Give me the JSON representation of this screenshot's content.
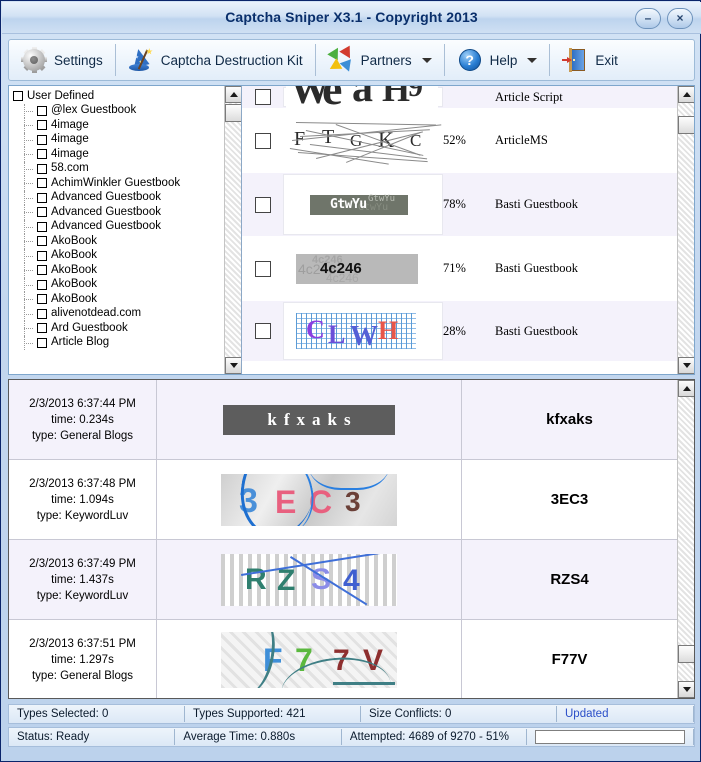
{
  "window": {
    "title": "Captcha Sniper X3.1 - Copyright 2013",
    "minimize_label": "–",
    "close_label": "×"
  },
  "toolbar": {
    "items": [
      {
        "label": "Settings",
        "icon": "gear-icon",
        "caret": false
      },
      {
        "label": "Captcha Destruction Kit",
        "icon": "wizard-hat-icon",
        "caret": false
      },
      {
        "label": "Partners",
        "icon": "arrows-icon",
        "caret": true
      },
      {
        "label": "Help",
        "icon": "question-circle-icon",
        "caret": true
      },
      {
        "label": "Exit",
        "icon": "exit-door-icon",
        "caret": false
      }
    ]
  },
  "tree": {
    "root": "User Defined",
    "items": [
      "@lex Guestbook",
      "4image",
      "4image",
      "4image",
      "58.com",
      "AchimWinkler Guestbook",
      "Advanced Guestbook",
      "Advanced Guestbook",
      "Advanced Guestbook",
      "AkoBook",
      "AkoBook",
      "AkoBook",
      "AkoBook",
      "AkoBook",
      "alivenotdead.com",
      "Ard Guestbook",
      "Article Blog"
    ]
  },
  "captcha_list": {
    "rows": [
      {
        "art": "script",
        "percent": "",
        "name": "Article Script",
        "partial": true
      },
      {
        "art": "ftgkc",
        "percent": "52%",
        "name": "ArticleMS",
        "partial": false
      },
      {
        "art": "gtwyu",
        "percent": "78%",
        "name": "Basti Guestbook",
        "partial": false
      },
      {
        "art": "4c246",
        "percent": "71%",
        "name": "Basti Guestbook",
        "partial": false
      },
      {
        "art": "clwh",
        "percent": "28%",
        "name": "Basti Guestbook",
        "partial": false
      }
    ],
    "art_text": {
      "ftgkc": [
        "F",
        "T",
        "G",
        "K",
        "C"
      ],
      "gtwyu_main": "GtwYu",
      "gtwyu_ghost1": "GtwYu",
      "gtwyu_ghost2": "GtwYu",
      "c4_main": "4c246",
      "c4_ghost1": "4c246",
      "c4_ghost2": "4c246",
      "c4_ghost3": "4c246",
      "clwh": [
        "C",
        "L",
        "W",
        "H"
      ]
    }
  },
  "results": {
    "rows": [
      {
        "timestamp": "2/3/2013 6:37:44 PM",
        "time": "time: 0.234s",
        "type": "type: General Blogs",
        "art": "kfxaks",
        "solved": "kfxaks"
      },
      {
        "timestamp": "2/3/2013 6:37:48 PM",
        "time": "time: 1.094s",
        "type": "type: KeywordLuv",
        "art": "3ec3",
        "solved": "3EC3"
      },
      {
        "timestamp": "2/3/2013 6:37:49 PM",
        "time": "time: 1.437s",
        "type": "type: KeywordLuv",
        "art": "rzs4",
        "solved": "RZS4"
      },
      {
        "timestamp": "2/3/2013 6:37:51 PM",
        "time": "time: 1.297s",
        "type": "type: General Blogs",
        "art": "f77v",
        "solved": "F77V"
      }
    ],
    "art_text": {
      "kfxaks": [
        "k",
        "f",
        "x",
        "a",
        "k",
        "s"
      ],
      "3ec3": [
        "3",
        "E",
        "C",
        "3"
      ],
      "rzs4": [
        "R",
        "Z",
        "S",
        "4"
      ],
      "f77v": [
        "F",
        "7",
        "7",
        "V"
      ]
    }
  },
  "statusbar_top": {
    "types_selected": "Types Selected: 0",
    "types_supported": "Types Supported: 421",
    "size_conflicts": "Size Conflicts: 0",
    "update_status": "Updated"
  },
  "statusbar_bottom": {
    "status": "Status: Ready",
    "average_time": "Average Time: 0.880s",
    "attempted": "Attempted: 4689 of 9270 - 51%",
    "progress_percent": 0
  },
  "colors": {
    "title_text": "#0a2f6b",
    "link": "#2b4fc8",
    "alt_row": "#f4f2fb",
    "accent": "#2e6fc4"
  }
}
